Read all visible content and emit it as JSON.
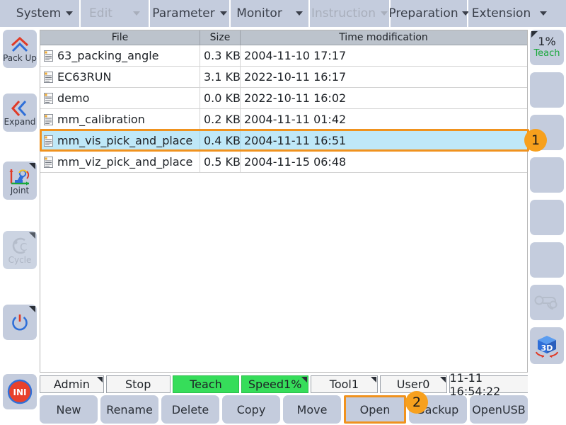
{
  "menubar": {
    "items": [
      {
        "label": "System",
        "disabled": false,
        "caret": "chevron-down-icon"
      },
      {
        "label": "Edit",
        "disabled": true,
        "caret": "chevron-down-icon"
      },
      {
        "label": "Parameter",
        "disabled": false,
        "caret": "chevron-down-icon"
      },
      {
        "label": "Monitor",
        "disabled": false,
        "caret": "chevron-down-icon"
      },
      {
        "label": "Instruction",
        "disabled": true,
        "caret": "chevron-down-icon"
      },
      {
        "label": "Preparation",
        "disabled": false,
        "caret": "chevron-down-icon"
      },
      {
        "label": "Extension",
        "disabled": false,
        "caret": "chevron-down-icon"
      }
    ]
  },
  "left_sidebar": {
    "items": [
      {
        "label": "Pack Up",
        "icon": "double-chevron-up-icon",
        "disabled": false
      },
      {
        "label": "Expand",
        "icon": "double-chevron-left-icon",
        "disabled": false
      },
      {
        "label": "Joint",
        "icon": "robot-joint-icon",
        "disabled": false
      },
      {
        "label": "Cycle",
        "icon": "cycle-icon",
        "disabled": true
      },
      {
        "label": "",
        "icon": "power-icon",
        "disabled": false
      },
      {
        "label": "",
        "icon": "ini-icon",
        "disabled": false
      }
    ],
    "ini_label": "INI"
  },
  "right_sidebar": {
    "speed_value": "1%",
    "speed_mode": "Teach",
    "items": [
      {
        "icon": "speed-teach-indicator"
      },
      {
        "icon": "blank-panel"
      },
      {
        "icon": "blank-panel"
      },
      {
        "icon": "blank-panel"
      },
      {
        "icon": "blank-panel"
      },
      {
        "icon": "blank-panel"
      },
      {
        "icon": "gripper-icon",
        "disabled": true
      },
      {
        "icon": "3d-cube-icon",
        "disabled": false
      }
    ],
    "cube_label": "3D"
  },
  "file_table": {
    "columns": [
      "File",
      "Size",
      "Time modification"
    ],
    "rows": [
      {
        "file": "63_packing_angle",
        "size": "0.3 KB",
        "time": "2004-11-10 17:17",
        "selected": false
      },
      {
        "file": "EC63RUN",
        "size": "3.1 KB",
        "time": "2022-10-11 16:17",
        "selected": false
      },
      {
        "file": "demo",
        "size": "0.0 KB",
        "time": "2022-10-11 16:02",
        "selected": false
      },
      {
        "file": "mm_calibration",
        "size": "0.2 KB",
        "time": "2004-11-11 01:42",
        "selected": false
      },
      {
        "file": "mm_vis_pick_and_place",
        "size": "0.4 KB",
        "time": "2004-11-11 16:51",
        "selected": true
      },
      {
        "file": "mm_viz_pick_and_place",
        "size": "0.5 KB",
        "time": "2004-11-15 06:48",
        "selected": false
      }
    ]
  },
  "statusbar": {
    "items": [
      {
        "label": "Admin",
        "green": false,
        "caret": true
      },
      {
        "label": "Stop",
        "green": false,
        "caret": false
      },
      {
        "label": "Teach",
        "green": true,
        "caret": false
      },
      {
        "label": "Speed1%",
        "green": true,
        "caret": true
      },
      {
        "label": "Tool1",
        "green": false,
        "caret": true
      },
      {
        "label": "User0",
        "green": false,
        "caret": true
      },
      {
        "label": "11-11 16:54:22",
        "green": false,
        "caret": false
      }
    ]
  },
  "bottom_buttons": [
    {
      "label": "New",
      "highlight": false
    },
    {
      "label": "Rename",
      "highlight": false
    },
    {
      "label": "Delete",
      "highlight": false
    },
    {
      "label": "Copy",
      "highlight": false
    },
    {
      "label": "Move",
      "highlight": false
    },
    {
      "label": "Open",
      "highlight": true
    },
    {
      "label": "Backup",
      "highlight": false
    },
    {
      "label": "OpenUSB",
      "highlight": false
    }
  ],
  "annotations": [
    {
      "number": "1"
    },
    {
      "number": "2"
    }
  ],
  "colors": {
    "accent_orange": "#f0921e",
    "badge_orange": "#f7a01d",
    "panel_blue": "#c4ccdd",
    "selection_cyan": "#bfe8f8",
    "status_green": "#36dd5a",
    "teach_green": "#19a83c"
  }
}
